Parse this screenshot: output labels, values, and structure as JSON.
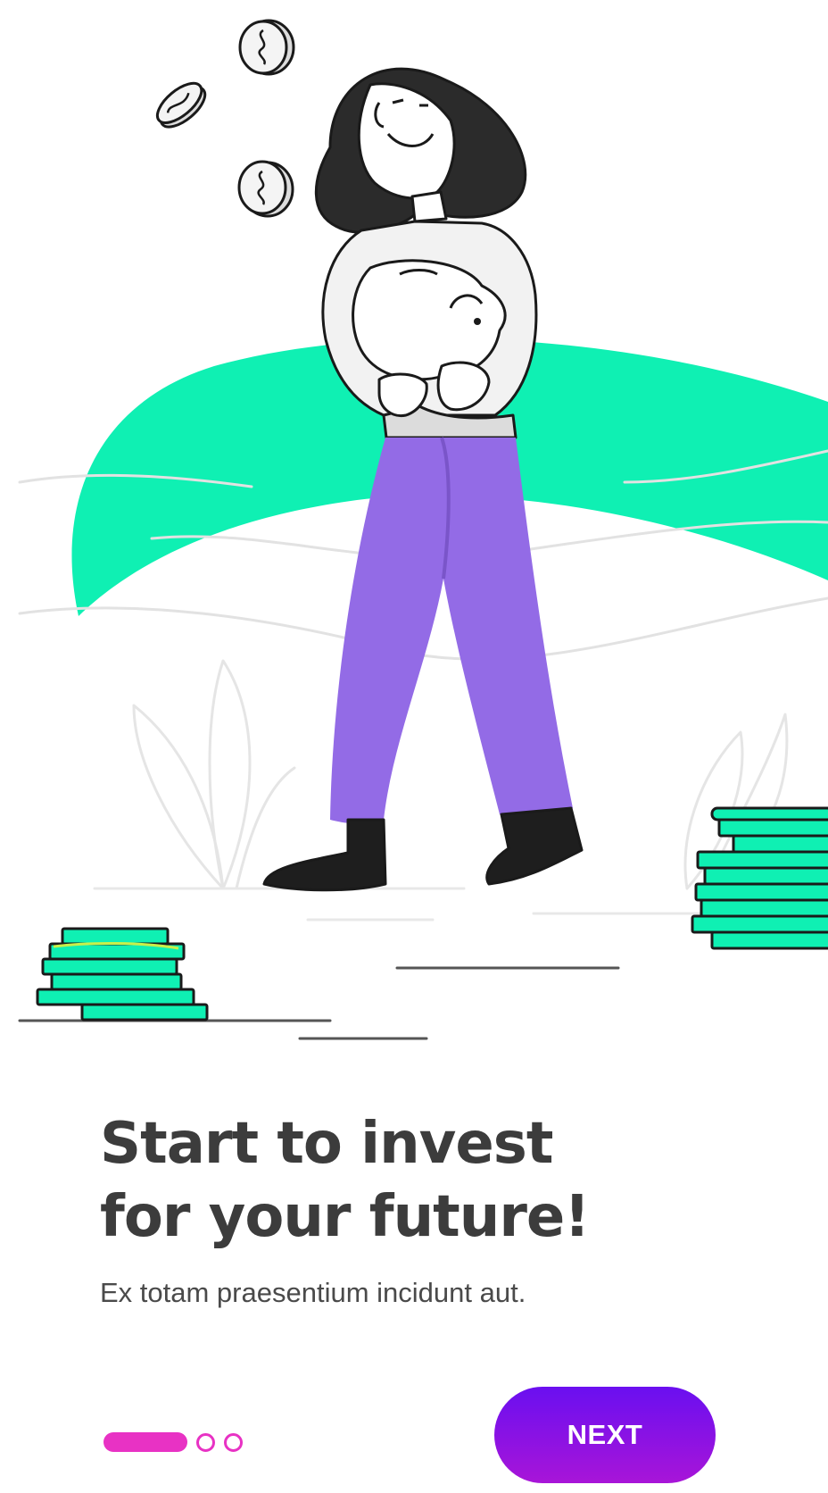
{
  "onboarding": {
    "headline_line1": "Start to invest",
    "headline_line2": "for your future!",
    "subtitle": "Ex totam praesentium incidunt aut.",
    "next_label": "NEXT"
  },
  "pager": {
    "total_pages": 3,
    "current_page": 1
  },
  "illustration": {
    "subject": "woman holding piggy bank",
    "elements": [
      "coin-icon",
      "coin-icon",
      "coin-icon",
      "piggy-bank-icon",
      "coin-stack-icon",
      "coin-stack-icon",
      "leaf-icon"
    ]
  },
  "colors": {
    "accent_green": "#0ff0b3",
    "pants_purple": "#936be6",
    "pager_pink": "#e832c4",
    "button_gradient_top": "#6a0ff0",
    "button_gradient_bottom": "#a815d8",
    "headline_text": "#3c3c3c",
    "body_text": "#4a4a4a"
  }
}
